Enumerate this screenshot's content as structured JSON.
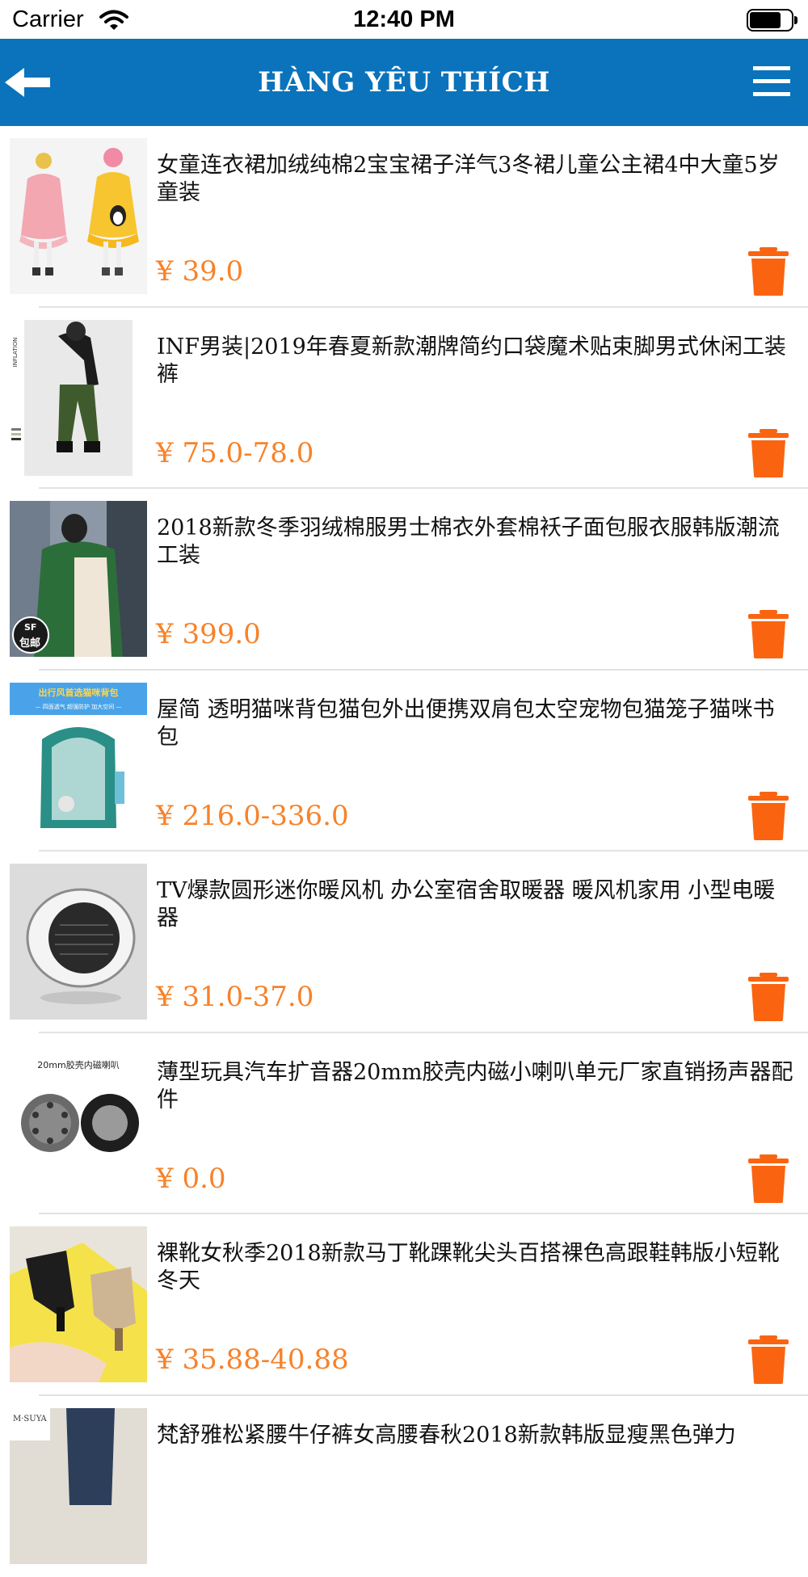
{
  "status": {
    "carrier": "Carrier",
    "time": "12:40 PM",
    "battery_level": 0.75
  },
  "header": {
    "title": "HÀNG YÊU THÍCH",
    "back_icon": "arrow-left-icon",
    "menu_icon": "hamburger-menu-icon",
    "bg_color": "#0a73bb"
  },
  "accent": {
    "price_color": "#f7822a",
    "delete_color": "#fa6410"
  },
  "items": [
    {
      "title": "女童连衣裙加绒纯棉2宝宝裙子洋气3冬裙儿童公主裙4中大童5岁童装",
      "price": "¥ 39.0"
    },
    {
      "title": "INF男装|2019年春夏新款潮牌简约口袋魔术贴束脚男式休闲工装裤",
      "price": "¥ 75.0-78.0"
    },
    {
      "title": "2018新款冬季羽绒棉服男士棉衣外套棉袄子面包服衣服韩版潮流工装",
      "price": "¥ 399.0"
    },
    {
      "title": "屋简 透明猫咪背包猫包外出便携双肩包太空宠物包猫笼子猫咪书包",
      "price": "¥ 216.0-336.0"
    },
    {
      "title": "TV爆款圆形迷你暖风机 办公室宿舍取暖器 暖风机家用 小型电暖器",
      "price": "¥ 31.0-37.0"
    },
    {
      "title": "薄型玩具汽车扩音器20mm胶壳内磁小喇叭单元厂家直销扬声器配件",
      "price": "¥ 0.0"
    },
    {
      "title": "裸靴女秋季2018新款马丁靴踝靴尖头百搭裸色高跟鞋韩版小短靴冬天",
      "price": "¥ 35.88-40.88"
    },
    {
      "title": "梵舒雅松紧腰牛仔裤女高腰春秋2018新款韩版显瘦黑色弹力",
      "price": ""
    }
  ],
  "thumb_texts": {
    "item2_side": "INFLATION",
    "item3_badge1": "SF",
    "item3_badge2": "包邮",
    "item4_banner": "出行风首选猫咪背包",
    "item4_banner_sub": "— 四面透气  超强防护  加大空间 —",
    "item6_label": "20mm胶壳内磁喇叭",
    "item8_label": "M·SUYA"
  }
}
